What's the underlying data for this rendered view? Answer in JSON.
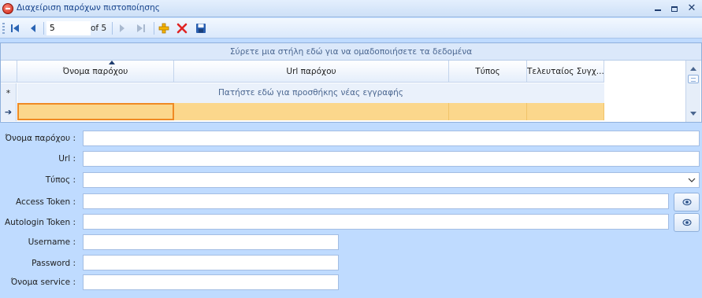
{
  "window": {
    "title": "Διαχείριση παρόχων πιστοποίησης",
    "controls": [
      "minimize-icon",
      "maximize-icon",
      "close-icon"
    ]
  },
  "navigator": {
    "position": "5",
    "of_text": "of 5",
    "icons": [
      "first-record-icon",
      "previous-record-icon",
      "next-record-icon",
      "last-record-icon",
      "add-icon",
      "delete-icon",
      "save-icon"
    ]
  },
  "grid": {
    "group_panel_text": "Σύρετε μια στήλη εδώ για να ομαδοποιήσετε τα δεδομένα",
    "columns": [
      "Όνομα παρόχου",
      "Url παρόχου",
      "Τύπος",
      "Τελευταίος Συγχ..."
    ],
    "new_row_text": "Πατήστε εδώ για προσθήκης νέας εγγραφής",
    "new_row_indicator": "*",
    "current_row_indicator": "➔"
  },
  "form": {
    "provider_name_label": "Όνομα παρόχου :",
    "url_label": "Url :",
    "type_label": "Τύπος :",
    "access_token_label": "Access Token :",
    "autologin_token_label": "Autologin Token :",
    "username_label": "Username :",
    "password_label": "Password :",
    "service_name_label": "Όνομα service :",
    "provider_name_value": "",
    "url_value": "",
    "type_value": "",
    "access_token_value": "",
    "autologin_token_value": "",
    "username_value": "",
    "password_value": "",
    "service_name_value": ""
  },
  "colors": {
    "background": "#bfdbff",
    "selected_row": "#fbd78c",
    "active_cell_border": "#ef8a24",
    "title_text": "#15428b"
  }
}
